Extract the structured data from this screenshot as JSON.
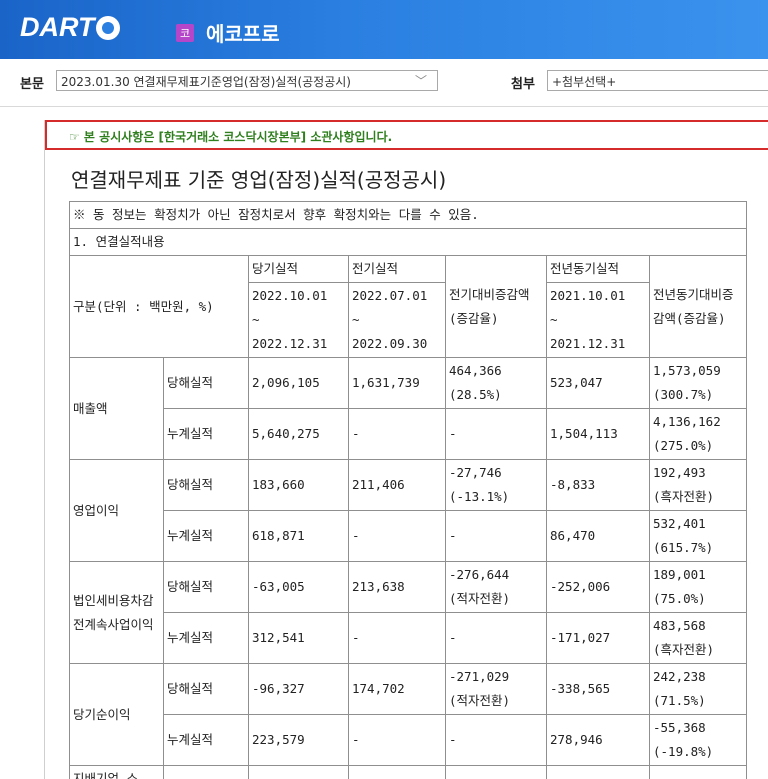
{
  "header": {
    "logo_text": "DART",
    "company_badge": "코",
    "company_name": "에코프로"
  },
  "selector": {
    "main_label": "본문",
    "main_value": "2023.01.30  연결재무제표기준영업(잠정)실적(공정공시)",
    "attach_label": "첨부",
    "attach_value": "+첨부선택+"
  },
  "notice": {
    "text": "☞ 본 공시사항은 [한국거래소 코스닥시장본부] 소관사항입니다."
  },
  "document": {
    "title": "연결재무제표 기준 영업(잠정)실적(공정공시)",
    "note": "※ 동 정보는 확정치가 아닌 잠정치로서 향후 확정치와는 다를 수 있음.",
    "section": "1. 연결실적내용"
  },
  "table": {
    "headers": {
      "category": "구분(단위 : 백만원, %)",
      "current_label": "당기실적",
      "current_period": [
        "2022.10.01",
        "~",
        "2022.12.31"
      ],
      "previous_label": "전기실적",
      "previous_period": [
        "2022.07.01",
        "~",
        "2022.09.30"
      ],
      "qoq": "전기대비증감액(증감율)",
      "yoy_label": "전년동기실적",
      "yoy_period": [
        "2021.10.01",
        "~",
        "2021.12.31"
      ],
      "yoy_change": "전년동기대비증감액(증감율)"
    },
    "groups": [
      {
        "name": "매출액",
        "rows": [
          {
            "type": "당해실적",
            "current": "2,096,105",
            "previous": "1,631,739",
            "qoq": [
              "464,366",
              "(28.5%)"
            ],
            "yoy": "523,047",
            "yoy_change": [
              "1,573,059",
              "(300.7%)"
            ]
          },
          {
            "type": "누계실적",
            "current": "5,640,275",
            "previous": "-",
            "qoq": [
              "-"
            ],
            "yoy": "1,504,113",
            "yoy_change": [
              "4,136,162",
              "(275.0%)"
            ]
          }
        ]
      },
      {
        "name": "영업이익",
        "rows": [
          {
            "type": "당해실적",
            "current": "183,660",
            "previous": "211,406",
            "qoq": [
              "-27,746",
              "(-13.1%)"
            ],
            "yoy": "-8,833",
            "yoy_change": [
              "192,493",
              "(흑자전환)"
            ]
          },
          {
            "type": "누계실적",
            "current": "618,871",
            "previous": "-",
            "qoq": [
              "-"
            ],
            "yoy": "86,470",
            "yoy_change": [
              "532,401",
              "(615.7%)"
            ]
          }
        ]
      },
      {
        "name": "법인세비용차감전계속사업이익",
        "rows": [
          {
            "type": "당해실적",
            "current": "-63,005",
            "previous": "213,638",
            "qoq": [
              "-276,644",
              "(적자전환)"
            ],
            "yoy": "-252,006",
            "yoy_change": [
              "189,001",
              "(75.0%)"
            ]
          },
          {
            "type": "누계실적",
            "current": "312,541",
            "previous": "-",
            "qoq": [
              "-"
            ],
            "yoy": "-171,027",
            "yoy_change": [
              "483,568",
              "(흑자전환)"
            ]
          }
        ]
      },
      {
        "name": "당기순이익",
        "rows": [
          {
            "type": "당해실적",
            "current": "-96,327",
            "previous": "174,702",
            "qoq": [
              "-271,029",
              "(적자전환)"
            ],
            "yoy": "-338,565",
            "yoy_change": [
              "242,238",
              "(71.5%)"
            ]
          },
          {
            "type": "누계실적",
            "current": "223,579",
            "previous": "-",
            "qoq": [
              "-"
            ],
            "yoy": "278,946",
            "yoy_change": [
              "-55,368",
              "(-19.8%)"
            ]
          }
        ]
      }
    ],
    "partial_last_row_label": "지배기업 소"
  }
}
